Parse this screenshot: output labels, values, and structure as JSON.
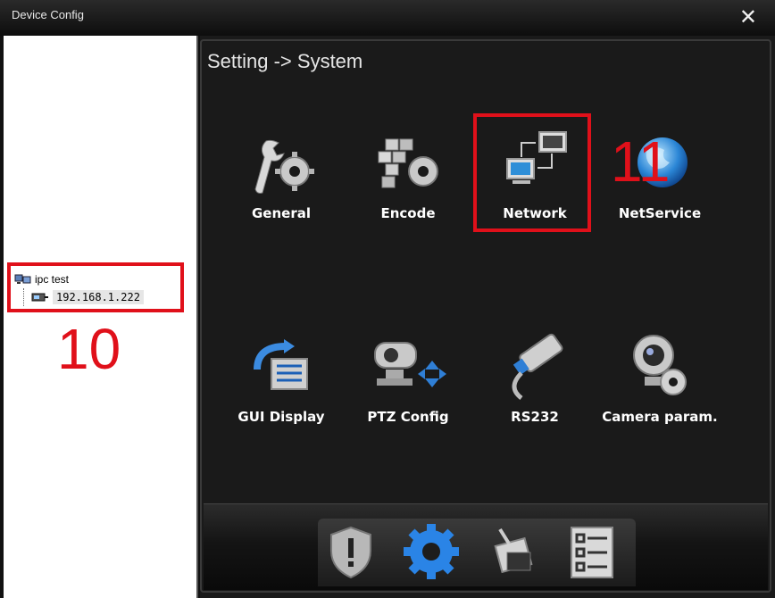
{
  "window": {
    "title": "Device Config",
    "close_glyph": "✕"
  },
  "tree": {
    "root_label": "ipc test",
    "child_label": "192.168.1.222"
  },
  "main": {
    "breadcrumb": "Setting -> System",
    "tiles": [
      {
        "label": "General",
        "icon": "wrench-gear-icon"
      },
      {
        "label": "Encode",
        "icon": "blocks-gear-icon"
      },
      {
        "label": "Network",
        "icon": "network-computers-icon"
      },
      {
        "label": "NetService",
        "icon": "globe-icon"
      },
      {
        "label": "GUI Display",
        "icon": "monitor-refresh-icon"
      },
      {
        "label": "PTZ Config",
        "icon": "ptz-camera-icon"
      },
      {
        "label": "RS232",
        "icon": "serial-cable-icon"
      },
      {
        "label": "Camera param.",
        "icon": "webcam-gear-icon"
      }
    ]
  },
  "dock": [
    {
      "icon": "shield-alarm-icon"
    },
    {
      "icon": "gear-icon",
      "selected": true
    },
    {
      "icon": "tools-icon"
    },
    {
      "icon": "checklist-icon"
    }
  ],
  "annotations": {
    "left_number": "10",
    "right_number": "11",
    "color": "#e0101a"
  }
}
